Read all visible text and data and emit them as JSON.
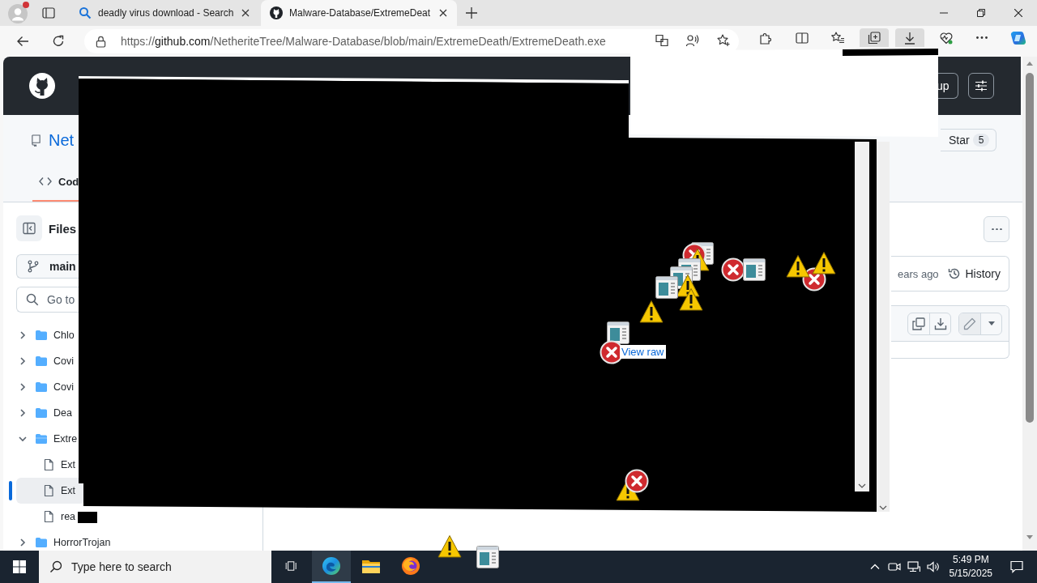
{
  "browser": {
    "profile_alert": true
  },
  "tabs": [
    {
      "kind": "search",
      "label": "deadly virus download - Search",
      "selected": false
    },
    {
      "kind": "github",
      "label": "Malware-Database/ExtremeDeat",
      "selected": true
    }
  ],
  "address_bar": {
    "scheme": "https://",
    "host": "github.com",
    "path": "/NetheriteTree/Malware-Database/blob/main/ExtremeDeath/ExtremeDeath.exe",
    "actions": [
      {
        "kind": "translate"
      },
      {
        "kind": "read-aloud"
      },
      {
        "kind": "favorite"
      }
    ]
  },
  "toolbar": [
    {
      "kind": "extensions",
      "highlighted": false
    },
    {
      "kind": "split-screen",
      "highlighted": false
    },
    {
      "kind": "favorites",
      "highlighted": false
    },
    {
      "kind": "collections",
      "highlighted": true
    },
    {
      "kind": "downloads",
      "highlighted": true
    },
    {
      "kind": "performance",
      "highlighted": false
    },
    {
      "kind": "more",
      "highlighted": false
    },
    {
      "kind": "copilot",
      "highlighted": false
    }
  ],
  "github_header": {
    "button_label": "up"
  },
  "repo": {
    "name": "Net",
    "star_label": "Star",
    "star_count": "5"
  },
  "repo_tabs": [
    {
      "label": "Cod",
      "selected": true
    }
  ],
  "sidebar": {
    "title": "Files",
    "branch": "main",
    "search_placeholder": "Go to",
    "tree": [
      {
        "kind": "folder",
        "name": "Chlo",
        "expanded": false,
        "selected": false
      },
      {
        "kind": "folder",
        "name": "Covi",
        "expanded": false,
        "selected": false
      },
      {
        "kind": "folder",
        "name": "Covi",
        "expanded": false,
        "selected": false
      },
      {
        "kind": "folder",
        "name": "Dea",
        "expanded": false,
        "selected": false
      },
      {
        "kind": "folder",
        "name": "Extre",
        "expanded": true,
        "selected": false,
        "children": [
          {
            "kind": "file",
            "name": "Ext",
            "selected": false
          },
          {
            "kind": "file",
            "name": "Ext",
            "selected": true
          },
          {
            "kind": "file",
            "name": "rea",
            "selected": false
          }
        ]
      },
      {
        "kind": "folder",
        "name": "HorrorTrojan",
        "expanded": false,
        "selected": false
      }
    ]
  },
  "file_view": {
    "commit_time": "ears ago",
    "history_label": "History"
  },
  "overlay": {
    "link_label": "View raw",
    "popup_icons": [
      {
        "kind": "window"
      },
      {
        "kind": "error"
      },
      {
        "kind": "warning"
      },
      {
        "kind": "window"
      },
      {
        "kind": "window"
      },
      {
        "kind": "warning"
      },
      {
        "kind": "window"
      },
      {
        "kind": "warning"
      },
      {
        "kind": "warning"
      },
      {
        "kind": "window"
      },
      {
        "kind": "error"
      },
      {
        "kind": "error"
      },
      {
        "kind": "window"
      },
      {
        "kind": "error"
      },
      {
        "kind": "warning"
      },
      {
        "kind": "warning"
      },
      {
        "kind": "warning"
      },
      {
        "kind": "error"
      },
      {
        "kind": "warning"
      },
      {
        "kind": "window"
      }
    ]
  },
  "taskbar": {
    "search_placeholder": "Type here to search",
    "apps": [
      {
        "kind": "task-view",
        "selected": false
      },
      {
        "kind": "edge",
        "selected": true
      },
      {
        "kind": "explorer",
        "selected": false
      },
      {
        "kind": "firefox",
        "selected": false
      }
    ],
    "time": "5:49 PM",
    "date": "5/15/2025"
  }
}
